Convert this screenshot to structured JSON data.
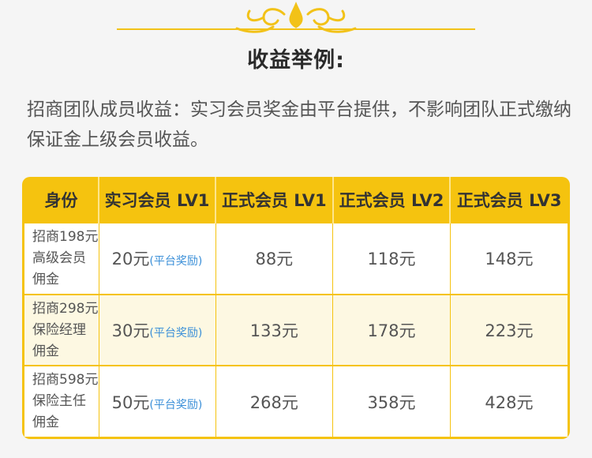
{
  "heading": "收益举例:",
  "description": "招商团队成员收益：实习会员奖金由平台提供，不影响团队正式缴纳保证金上级会员收益。",
  "table": {
    "headers": [
      "身份",
      "实习会员 LV1",
      "正式会员 LV1",
      "正式会员 LV2",
      "正式会员 LV3"
    ],
    "rows": [
      {
        "label": "招商198元高级会员佣金",
        "intern": "20元",
        "intern_note": "(平台奖励)",
        "lv1": "88元",
        "lv2": "118元",
        "lv3": "148元"
      },
      {
        "label": "招商298元保险经理佣金",
        "intern": "30元",
        "intern_note": "(平台奖励)",
        "lv1": "133元",
        "lv2": "178元",
        "lv3": "223元"
      },
      {
        "label": "招商598元保险主任佣金",
        "intern": "50元",
        "intern_note": "(平台奖励)",
        "lv1": "268元",
        "lv2": "358元",
        "lv3": "428元"
      }
    ]
  },
  "colors": {
    "accent": "#f5c30f",
    "note": "#3a8fd8"
  }
}
